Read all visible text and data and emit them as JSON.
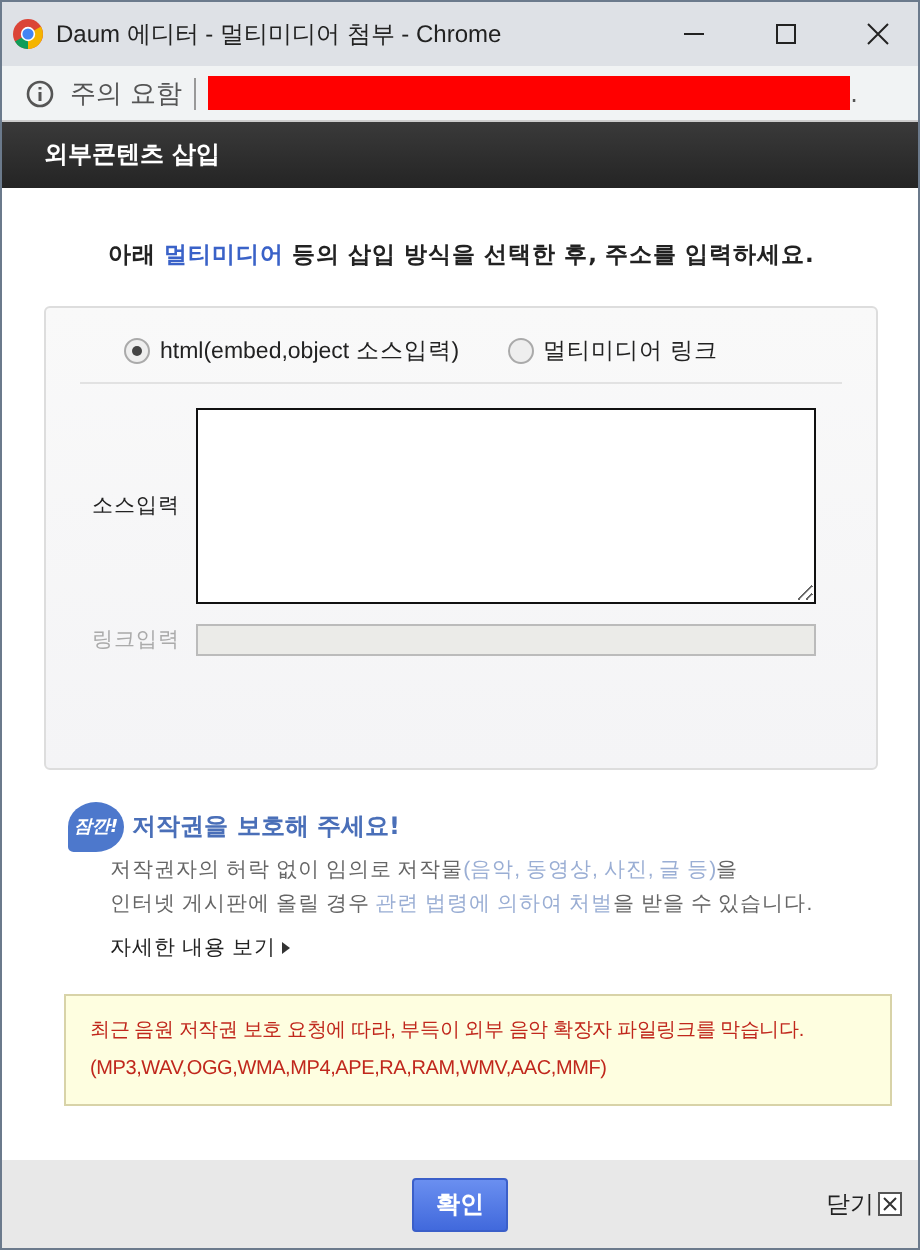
{
  "window": {
    "title": "Daum 에디터 - 멀티미디어 첨부 - Chrome"
  },
  "address_bar": {
    "security_label": "주의 요함",
    "url_suffix": "."
  },
  "header": {
    "title": "외부콘텐츠 삽입"
  },
  "instruction": [
    {
      "text": "아래 ",
      "kind": "plain"
    },
    {
      "text": "멀티미디어",
      "kind": "highlight"
    },
    {
      "text": " 등의 삽입 방식을 선택한 후, 주소를 입력하세요.",
      "kind": "plain"
    }
  ],
  "modes": [
    {
      "label": "html(embed,object 소스입력)",
      "selected": true
    },
    {
      "label": "멀티미디어 링크",
      "selected": false
    }
  ],
  "fields": [
    {
      "label": "소스입력",
      "kind": "textarea",
      "disabled": false
    },
    {
      "label": "링크입력",
      "kind": "input",
      "disabled": true
    }
  ],
  "notice": {
    "badge": "잠깐!",
    "title": "저작권을 보호해 주세요!",
    "body": [
      [
        {
          "text": "저작권자의 허락 없이 임의로 저작물",
          "kind": "plain"
        },
        {
          "text": "(음악, 동영상, 사진, 글 등)",
          "kind": "highlight"
        },
        {
          "text": "을",
          "kind": "plain"
        }
      ],
      [
        {
          "text": "인터넷 게시판에 올릴 경우 ",
          "kind": "plain"
        },
        {
          "text": "관련 법령에 의하여 처벌",
          "kind": "highlight"
        },
        {
          "text": "을 받을 수 있습니다.",
          "kind": "plain"
        }
      ]
    ],
    "more_link": "자세한 내용 보기"
  },
  "warning": {
    "lines": [
      "최근 음원 저작권 보호 요청에 따라, 부득이 외부 음악 확장자 파일링크를 막습니다.",
      "(MP3,WAV,OGG,WMA,MP4,APE,RA,RAM,WMV,AAC,MMF)"
    ]
  },
  "footer": {
    "confirm": "확인",
    "close": "닫기"
  }
}
